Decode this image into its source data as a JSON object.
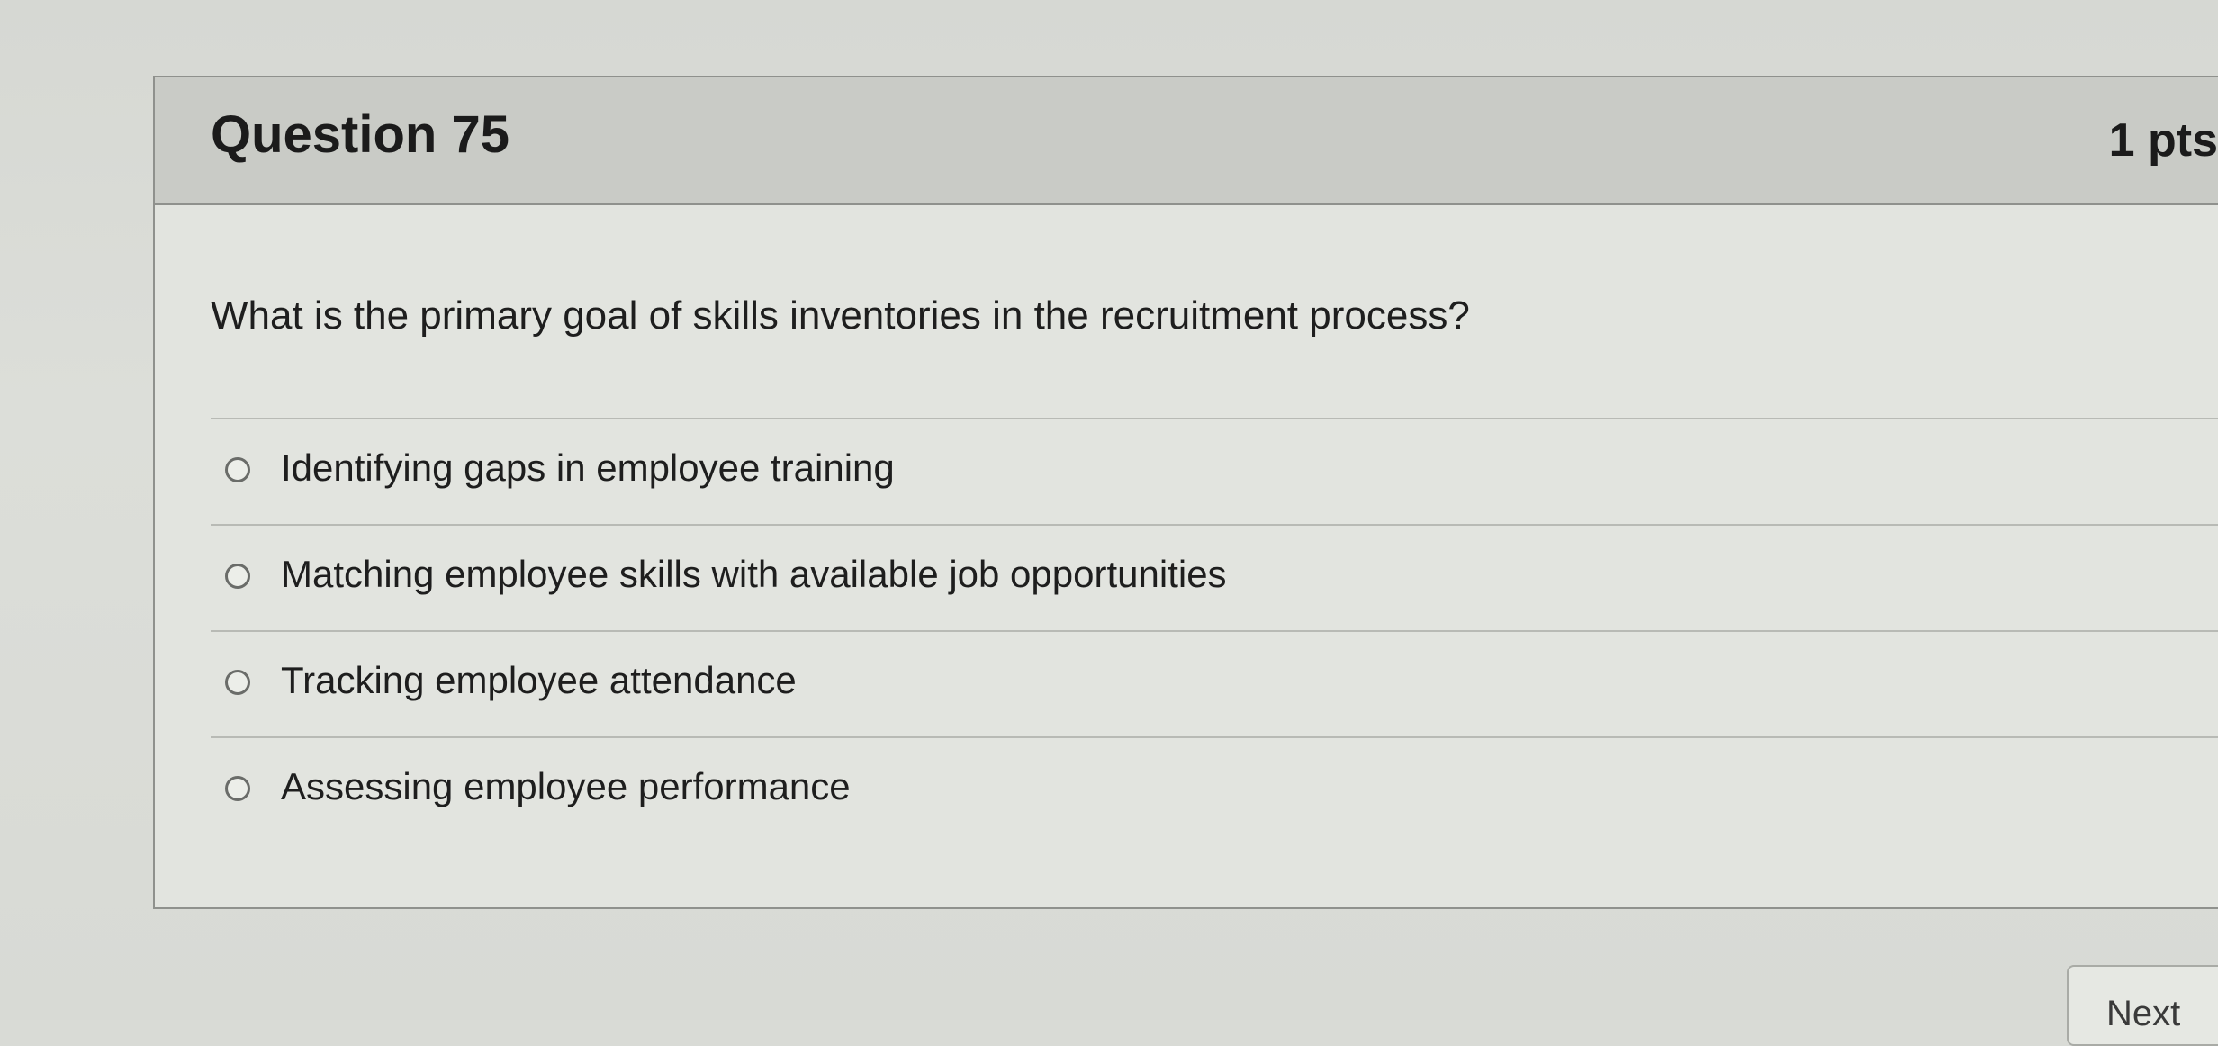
{
  "question": {
    "title": "Question 75",
    "points": "1 pts",
    "text": "What is the primary goal of skills inventories in the recruitment process?",
    "answers": [
      {
        "label": "Identifying gaps in employee training",
        "selected": false
      },
      {
        "label": "Matching employee skills with available job opportunities",
        "selected": false
      },
      {
        "label": "Tracking employee attendance",
        "selected": false
      },
      {
        "label": "Assessing employee performance",
        "selected": false
      }
    ]
  },
  "navigation": {
    "next_label": "Next"
  }
}
